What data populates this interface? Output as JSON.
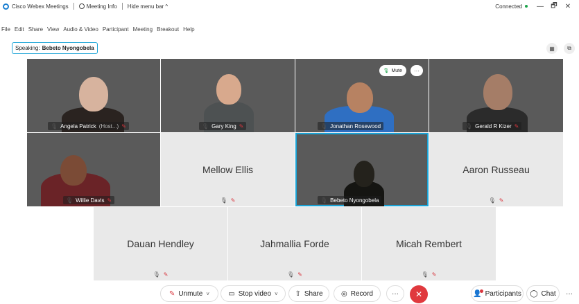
{
  "titlebar": {
    "app_name": "Cisco Webex Meetings",
    "meeting_info": "Meeting Info",
    "hide_menu": "Hide menu bar ^",
    "status": "Connected",
    "status_color": "#1ca34a",
    "min": "—",
    "restore": "🗗",
    "close": "✕"
  },
  "menubar": [
    "File",
    "Edit",
    "Share",
    "View",
    "Audio & Video",
    "Participant",
    "Meeting",
    "Breakout",
    "Help"
  ],
  "speaking": {
    "label": "Speaking:",
    "name": "Bebeto Nyongobela"
  },
  "layout_icon": "grid-icon",
  "popout_icon": "popout-icon",
  "tiles": {
    "angela": {
      "name": "Angela Patrick",
      "host": "(Host...)"
    },
    "gary": {
      "name": "Gary King"
    },
    "jonathan": {
      "name": "Jonathan Rosewood",
      "mute_label": "Mute",
      "more": "···"
    },
    "gerald": {
      "name": "Gerald R Kizer"
    },
    "willie": {
      "name": "Willie Davis"
    },
    "mellow": {
      "name": "Mellow Ellis"
    },
    "bebeto": {
      "name": "Bebeto Nyongobela"
    },
    "aaron": {
      "name": "Aaron Russeau"
    },
    "dauan": {
      "name": "Dauan Hendley"
    },
    "jahmallia": {
      "name": "Jahmallia Forde"
    },
    "micah": {
      "name": "Micah Rembert"
    }
  },
  "toolbar": {
    "unmute": "Unmute",
    "stop_video": "Stop video",
    "share": "Share",
    "record": "Record",
    "more": "···",
    "end": "✕",
    "participants": "Participants",
    "chat": "Chat",
    "overflow": "···"
  },
  "colors": {
    "accent": "#19a3d6",
    "muted": "#d9363e",
    "end_call": "#e0393e"
  }
}
